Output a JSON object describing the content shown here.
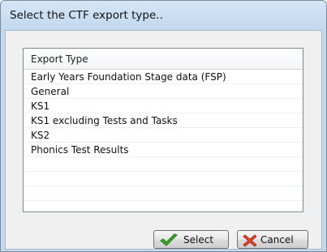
{
  "dialog": {
    "title": "Select the CTF export type.."
  },
  "list": {
    "header": "Export Type",
    "items": [
      "Early Years Foundation Stage data (FSP)",
      "General",
      "KS1",
      "KS1 excluding Tests and Tasks",
      "KS2",
      "Phonics Test Results",
      "",
      "",
      ""
    ]
  },
  "buttons": {
    "select_label": "Select",
    "cancel_label": "Cancel"
  },
  "icons": {
    "select": "green-checkmark-icon",
    "cancel": "red-x-icon"
  }
}
